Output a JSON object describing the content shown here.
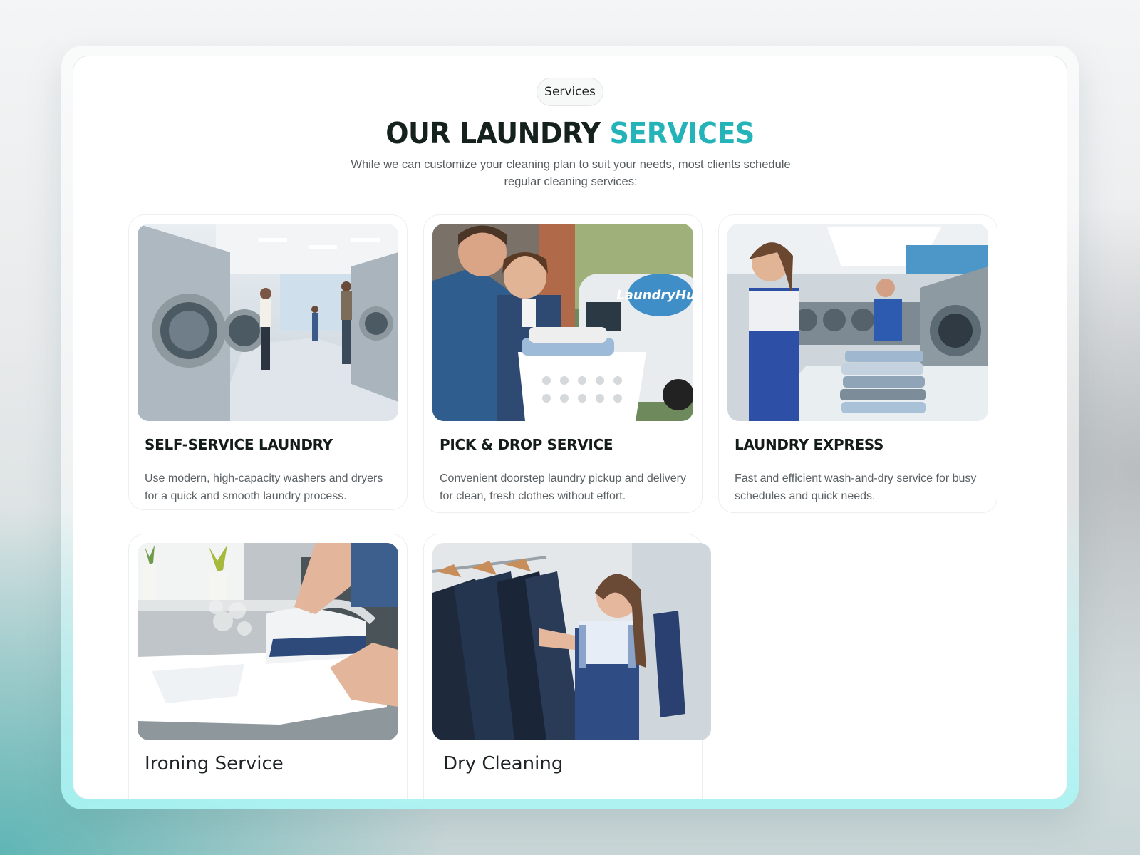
{
  "badge": "Services",
  "heading": {
    "part1": "OUR LAUNDRY ",
    "part2": "SERVICES",
    "accent_color": "#23b3b8"
  },
  "subtitle": "While we can customize your cleaning plan to suit your needs, most clients schedule regular cleaning services:",
  "cards": [
    {
      "title": "SELF-SERVICE LAUNDRY",
      "desc": "Use modern, high-capacity washers and dryers for a quick and smooth laundry process.",
      "image": "laundromat-photo"
    },
    {
      "title": "PICK & DROP SERVICE",
      "desc": "Convenient doorstep laundry pickup and delivery for clean, fresh clothes without effort.",
      "image": "pickup-delivery-photo",
      "van_logo": "LaundryHub"
    },
    {
      "title": "LAUNDRY EXPRESS",
      "desc": "Fast and efficient wash-and-dry service for busy schedules and quick needs.",
      "image": "folding-clothes-photo"
    },
    {
      "title": "Ironing Service",
      "image": "ironing-photo"
    },
    {
      "title": "Dry Cleaning",
      "image": "dry-cleaning-photo"
    }
  ]
}
